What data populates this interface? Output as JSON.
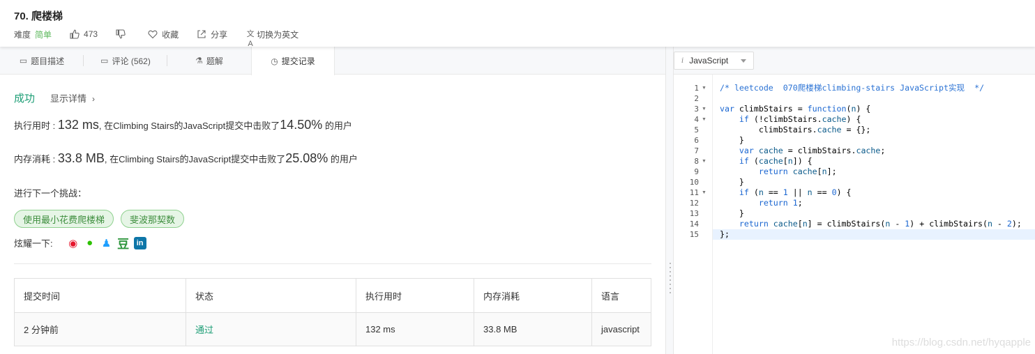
{
  "header": {
    "title": "70. 爬楼梯",
    "difficulty_label": "难度",
    "difficulty_value": "简单",
    "likes": "473",
    "collect_label": "收藏",
    "share_label": "分享",
    "switch_lang_label": "切换为英文"
  },
  "tabs": [
    {
      "label": "题目描述"
    },
    {
      "label": "评论 (562)"
    },
    {
      "label": "题解"
    },
    {
      "label": "提交记录"
    }
  ],
  "result": {
    "status": "成功",
    "detail_link": "显示详情",
    "runtime": {
      "label": "执行用时 : ",
      "value": "132 ms",
      "mid": ", 在Climbing Stairs的JavaScript提交中击败了",
      "percent": "14.50%",
      "suffix": " 的用户"
    },
    "memory": {
      "label": "内存消耗 : ",
      "value": "33.8 MB",
      "mid": ", 在Climbing Stairs的JavaScript提交中击败了",
      "percent": "25.08%",
      "suffix": " 的用户"
    },
    "challenge_label": "进行下一个挑战：",
    "challenges": [
      "使用最小花费爬楼梯",
      "斐波那契数"
    ],
    "share_label": "炫耀一下:"
  },
  "table": {
    "headers": [
      "提交时间",
      "状态",
      "执行用时",
      "内存消耗",
      "语言"
    ],
    "rows": [
      [
        "2 分钟前",
        "通过",
        "132 ms",
        "33.8 MB",
        "javascript"
      ]
    ]
  },
  "editor": {
    "language": "JavaScript",
    "line_numbers": [
      "1",
      "2",
      "3",
      "4",
      "5",
      "6",
      "7",
      "8",
      "9",
      "10",
      "11",
      "12",
      "13",
      "14",
      "15"
    ],
    "fold_lines": [
      1,
      3,
      4,
      8,
      11
    ],
    "current_line": 15,
    "code_lines": [
      "/* leetcode  070爬楼梯climbing-stairs JavaScript实现  */",
      "",
      "var climbStairs = function(n) {",
      "    if (!climbStairs.cache) {",
      "        climbStairs.cache = {};",
      "    }",
      "    var cache = climbStairs.cache;",
      "    if (cache[n]) {",
      "        return cache[n];",
      "    }",
      "    if (n == 1 || n == 0) {",
      "        return 1;",
      "    }",
      "    return cache[n] = climbStairs(n - 1) + climbStairs(n - 2);",
      "};"
    ]
  },
  "watermark": "https://blog.csdn.net/hyqapple"
}
